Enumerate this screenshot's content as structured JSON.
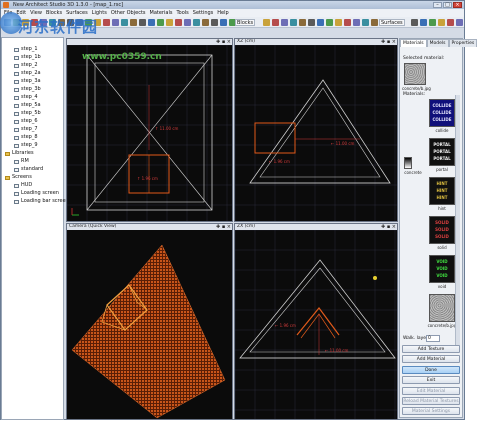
{
  "window": {
    "title": "New Architect Studio 3D 1.3.0 - [map_1.rsc]"
  },
  "menu": [
    "File",
    "Edit",
    "View",
    "Blocks",
    "Surfaces",
    "Lights",
    "Other Objects",
    "Materials",
    "Tools",
    "Settings",
    "Help"
  ],
  "toolbar": {
    "blocks_label": "Blocks",
    "surfaces_label": "Surfaces"
  },
  "tree": {
    "items": [
      {
        "label": "step_1",
        "kind": "file"
      },
      {
        "label": "step_1b",
        "kind": "file"
      },
      {
        "label": "step_2",
        "kind": "file"
      },
      {
        "label": "step_2a",
        "kind": "file"
      },
      {
        "label": "step_3a",
        "kind": "file"
      },
      {
        "label": "step_3b",
        "kind": "file"
      },
      {
        "label": "step_4",
        "kind": "file"
      },
      {
        "label": "step_5a",
        "kind": "file"
      },
      {
        "label": "step_5b",
        "kind": "file"
      },
      {
        "label": "step_6",
        "kind": "file"
      },
      {
        "label": "step_7",
        "kind": "file"
      },
      {
        "label": "step_8",
        "kind": "file"
      },
      {
        "label": "step_9",
        "kind": "file"
      },
      {
        "label": "Libraries",
        "kind": "folder"
      },
      {
        "label": "RM",
        "kind": "file"
      },
      {
        "label": "standard",
        "kind": "file"
      },
      {
        "label": "Screens",
        "kind": "folder"
      },
      {
        "label": "HUD",
        "kind": "file"
      },
      {
        "label": "Loading screen",
        "kind": "file"
      },
      {
        "label": "Loading bar screen",
        "kind": "file"
      }
    ]
  },
  "viewports": {
    "top": {
      "title": "",
      "measure_label": "↑ 11.00 cm",
      "box_label": "↑ 1.96 cm"
    },
    "front": {
      "title": "XZ (cm)",
      "measure_label": "← 11.00 cm",
      "box_label": "← 1.96 cm"
    },
    "camera": {
      "title": "Camera (Quick View)"
    },
    "side": {
      "title": "ZX (cm)",
      "measure_label": "← 11.00 cm",
      "box_label": "← 1.96 cm"
    }
  },
  "right_panel": {
    "tabs": [
      "Materials",
      "Models",
      "Properties"
    ],
    "selected_label": "Selected material:",
    "selected_name": "concrete/b.jpg",
    "materials_label": "Materials:",
    "materials": [
      {
        "name": "collide",
        "kind": "collide",
        "text": "COLLIDE"
      },
      {
        "name": "portal",
        "kind": "portal",
        "text": "PORTAL"
      },
      {
        "name": "hint",
        "kind": "hint",
        "text": "HINT"
      },
      {
        "name": "solid",
        "kind": "solid",
        "text": "SOLID"
      },
      {
        "name": "void",
        "kind": "void",
        "text": "VOID"
      },
      {
        "name": "concrete/b.jpg",
        "kind": "concrete",
        "text": ""
      }
    ],
    "texture_label": "concrete",
    "walk_label": "Walk. layer:",
    "walk_value": "0",
    "buttons": [
      "Add Texture",
      "Add Material",
      "Done",
      "Exit",
      "Edit Material",
      "Reload Material Textures",
      "Material Settings"
    ]
  },
  "watermark": {
    "text": "河东软件园",
    "url": "www.pc0359.cn"
  },
  "colors": {
    "viewport_bg": "#0b0b0b",
    "grid": "#2a2a3a",
    "pyramid": "#d0d0d0",
    "selection": "#e05a1a",
    "measure": "#d23b3b",
    "brick": "#c8551a"
  }
}
